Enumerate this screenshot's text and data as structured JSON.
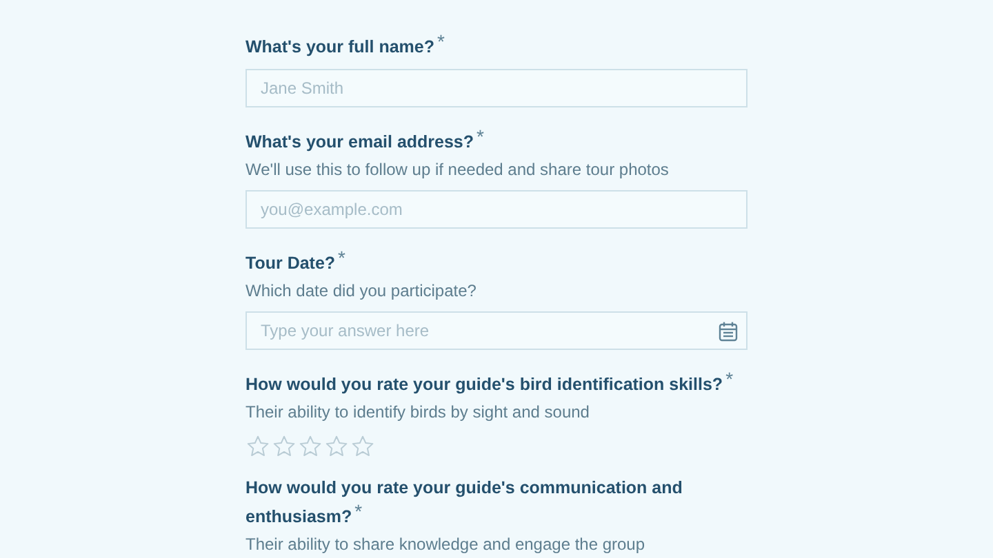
{
  "questions": [
    {
      "kind": "text",
      "title": "What's your full name?",
      "required_mark": "*",
      "placeholder": "Jane Smith"
    },
    {
      "kind": "text",
      "title": "What's your email address?",
      "required_mark": "*",
      "description": "We'll use this to follow up if needed and share tour photos",
      "placeholder": "you@example.com"
    },
    {
      "kind": "date",
      "title": "Tour Date?",
      "required_mark": "*",
      "description": "Which date did you participate?",
      "placeholder": "Type your answer here"
    },
    {
      "kind": "rating",
      "title": "How would you rate your guide's bird identification skills?",
      "required_mark": "*",
      "description": "Their ability to identify birds by sight and sound",
      "stars": 0
    },
    {
      "kind": "rating",
      "title": "How would you rate your guide's communication and enthusiasm?",
      "required_mark": "*",
      "description": "Their ability to share knowledge and engage the group"
    }
  ]
}
